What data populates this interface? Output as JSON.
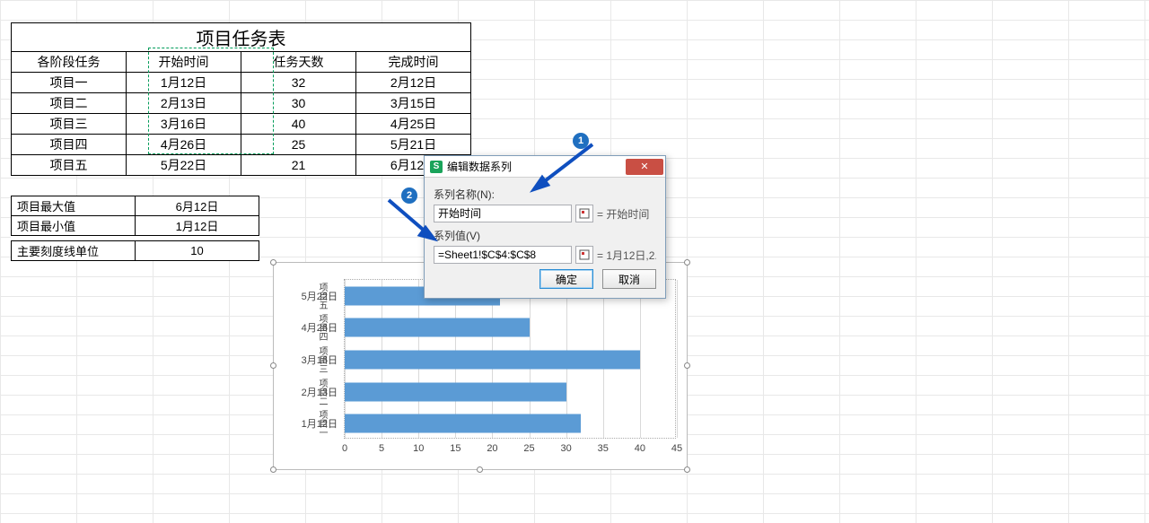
{
  "task_table": {
    "title": "项目任务表",
    "headers": [
      "各阶段任务",
      "开始时间",
      "任务天数",
      "完成时间"
    ],
    "rows": [
      {
        "c0": "项目一",
        "c1": "1月12日",
        "c2": "32",
        "c3": "2月12日"
      },
      {
        "c0": "项目二",
        "c1": "2月13日",
        "c2": "30",
        "c3": "3月15日"
      },
      {
        "c0": "项目三",
        "c1": "3月16日",
        "c2": "40",
        "c3": "4月25日"
      },
      {
        "c0": "项目四",
        "c1": "4月26日",
        "c2": "25",
        "c3": "5月21日"
      },
      {
        "c0": "项目五",
        "c1": "5月22日",
        "c2": "21",
        "c3": "6月12日"
      }
    ]
  },
  "summary": {
    "max_label": "项目最大值",
    "max_value": "6月12日",
    "min_label": "项目最小值",
    "min_value": "1月12日",
    "tick_label": "主要刻度线单位",
    "tick_value": "10"
  },
  "dialog": {
    "title": "编辑数据系列",
    "name_label": "系列名称(N):",
    "name_value": "开始时间",
    "name_readout": "= 开始时间",
    "values_label": "系列值(V)",
    "values_value": "=Sheet1!$C$4:$C$8",
    "values_readout": "= 1月12日,2...",
    "ok": "确定",
    "cancel": "取消"
  },
  "badges": {
    "b1": "1",
    "b2": "2"
  },
  "chart_data": {
    "type": "bar",
    "orientation": "horizontal",
    "categories": [
      "项目一",
      "项目二",
      "项目三",
      "项目四",
      "项目五"
    ],
    "y_tick_labels": [
      "1月12日",
      "2月13日",
      "3月16日",
      "4月26日",
      "5月22日"
    ],
    "values": [
      32,
      30,
      40,
      25,
      21
    ],
    "title": "",
    "xlabel": "",
    "ylabel": "",
    "xlim": [
      0,
      45
    ],
    "x_ticks": [
      0,
      5,
      10,
      15,
      20,
      25,
      30,
      35,
      40,
      45
    ]
  }
}
